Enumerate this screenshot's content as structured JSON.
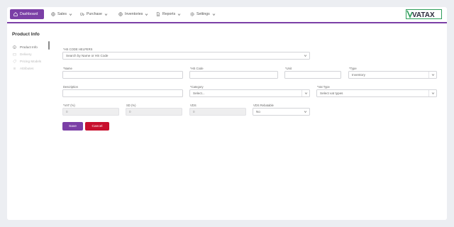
{
  "nav": {
    "items": [
      {
        "label": "Dashboard",
        "icon": "home-icon"
      },
      {
        "label": "Sales",
        "icon": "globe-icon"
      },
      {
        "label": "Purchase",
        "icon": "truck-icon"
      },
      {
        "label": "Inventories",
        "icon": "globe-icon"
      },
      {
        "label": "Reports",
        "icon": "file-icon"
      },
      {
        "label": "Settings",
        "icon": "gear-icon"
      }
    ],
    "logo_text": "VATAX"
  },
  "page": {
    "title": "Product Info"
  },
  "sidebar": {
    "items": [
      {
        "label": "Product Info",
        "active": true
      },
      {
        "label": "Delivery",
        "active": false
      },
      {
        "label": "Pricing Models",
        "active": false
      },
      {
        "label": "Attributes",
        "active": false
      }
    ]
  },
  "form": {
    "hs_helper": {
      "label": "*HS CODE HELPERS",
      "placeholder": "Search by Name or HS Code"
    },
    "name": {
      "label": "*Name",
      "value": ""
    },
    "hs_code": {
      "label": "*HS Code",
      "value": ""
    },
    "unit": {
      "label": "*Unit",
      "value": ""
    },
    "type": {
      "label": "*Type",
      "value": "Inventory"
    },
    "description": {
      "label": "Description",
      "value": ""
    },
    "category": {
      "label": "*Category",
      "value": "Select..."
    },
    "vat_type": {
      "label": "*Vat Type",
      "value": "Select vat types"
    },
    "vat": {
      "label": "*VAT (%)",
      "value": "0"
    },
    "sd": {
      "label": "SD (%)",
      "value": "0"
    },
    "vds": {
      "label": "VDS",
      "value": "0"
    },
    "vds_rebatable": {
      "label": "VDS Rebatable",
      "value": "No"
    },
    "save_label": "Save",
    "cancel_label": "Cancel"
  },
  "colors": {
    "accent": "#7b3fa6",
    "danger": "#c8102e",
    "logo_green": "#2e9e5b"
  }
}
